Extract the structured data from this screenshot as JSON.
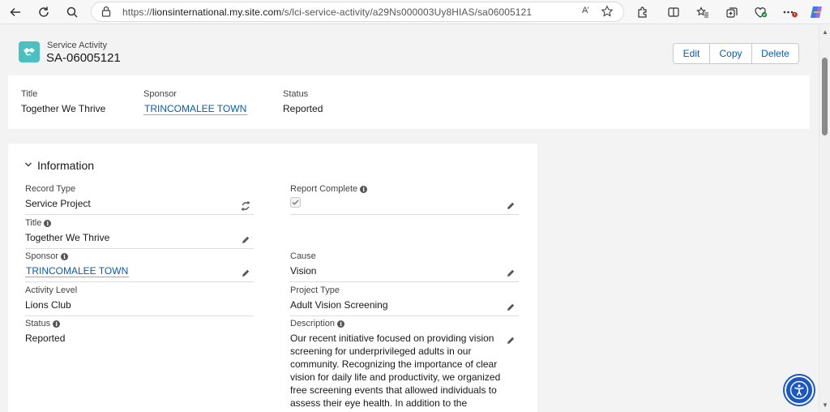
{
  "browser": {
    "url_prefix": "https://",
    "url_host": "lionsinternational.my.site.com",
    "url_path": "/s/lci-service-activity/a29Ns000003Uy8HIAS/sa06005121",
    "read_aloud": "A’"
  },
  "record": {
    "type_label": "Service Activity",
    "name": "SA-06005121",
    "actions": [
      "Edit",
      "Copy",
      "Delete"
    ]
  },
  "highlights": {
    "title_label": "Title",
    "title_value": "Together We Thrive",
    "sponsor_label": "Sponsor",
    "sponsor_value": "TRINCOMALEE TOWN",
    "status_label": "Status",
    "status_value": "Reported"
  },
  "information": {
    "section_title": "Information",
    "record_type_label": "Record Type",
    "record_type_value": "Service Project",
    "report_complete_label": "Report Complete",
    "title_label": "Title",
    "title_value": "Together We Thrive",
    "sponsor_label": "Sponsor",
    "sponsor_value": "TRINCOMALEE TOWN",
    "cause_label": "Cause",
    "cause_value": "Vision",
    "activity_level_label": "Activity Level",
    "activity_level_value": "Lions Club",
    "project_type_label": "Project Type",
    "project_type_value": "Adult Vision Screening",
    "status_label": "Status",
    "status_value": "Reported",
    "description_label": "Description",
    "description_value": "Our recent initiative focused on providing vision screening for underprivileged adults in our community. Recognizing the importance of clear vision for daily life and productivity, we organized free screening events that allowed individuals to assess their eye health. In addition to the screenings, we distributed..."
  },
  "colors": {
    "accent": "#0b5cab",
    "record_icon": "#4bc0c0",
    "accessibility_button": "#1a56c4"
  }
}
